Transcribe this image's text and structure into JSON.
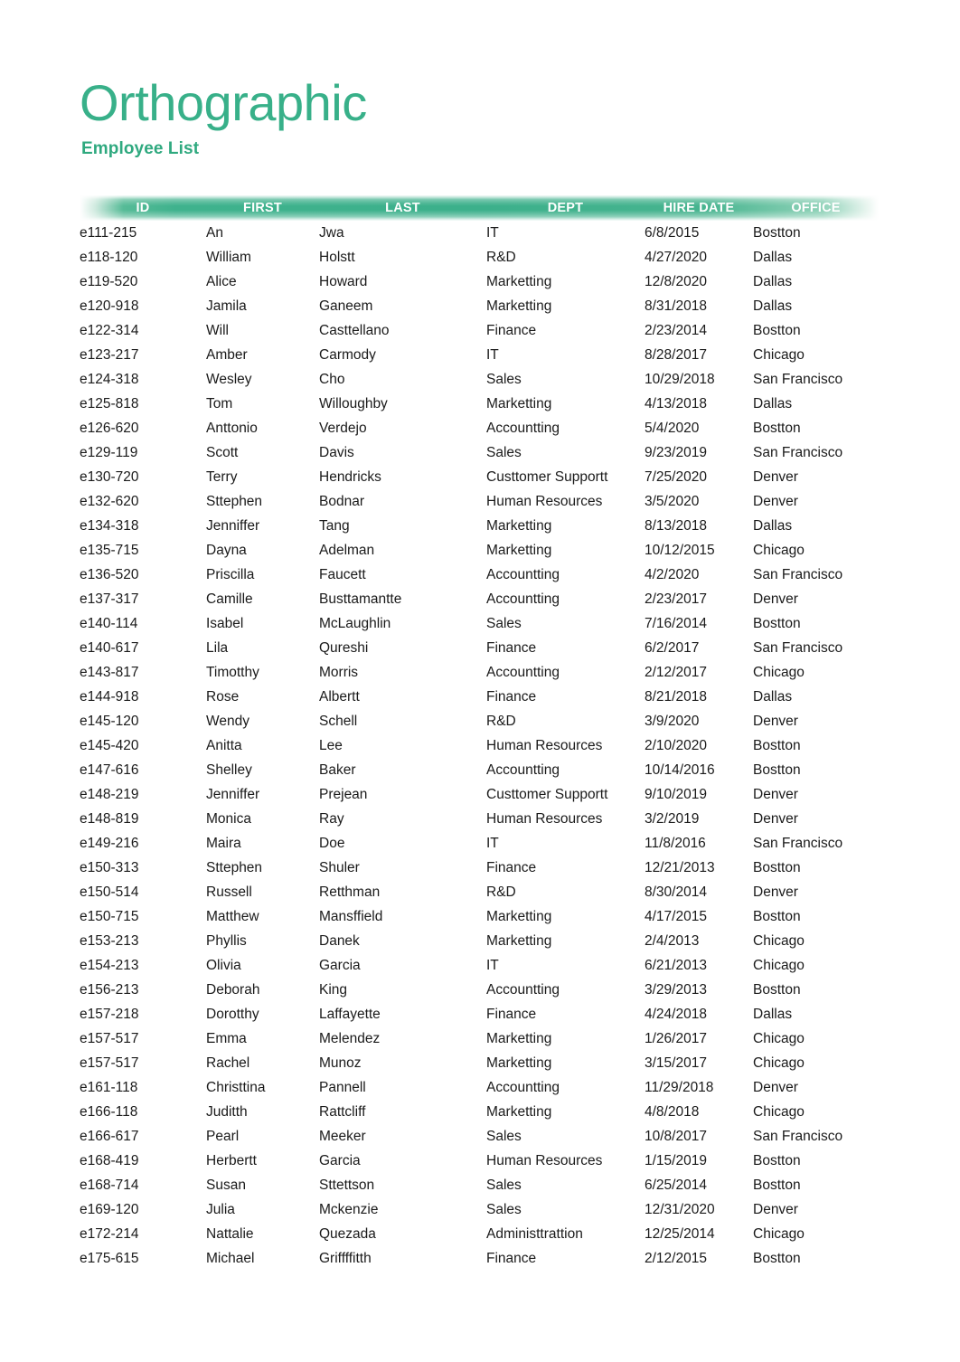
{
  "document": {
    "title": "Orthographic",
    "subtitle": "Employee List",
    "accent_color": "#38b089",
    "subtitle_color": "#2fa97f",
    "header_band_color": "#3cb08b",
    "text_color": "#1a1a1a"
  },
  "table": {
    "columns": [
      {
        "key": "id",
        "label": "ID"
      },
      {
        "key": "first",
        "label": "FIRST"
      },
      {
        "key": "last",
        "label": "LAST"
      },
      {
        "key": "dept",
        "label": "DEPT"
      },
      {
        "key": "hire",
        "label": "HIRE DATE"
      },
      {
        "key": "office",
        "label": "OFFICE"
      }
    ],
    "rows": [
      {
        "id": "e111-215",
        "first": "An",
        "last": "Jwa",
        "dept": "IT",
        "hire": "6/8/2015",
        "office": "Bostton"
      },
      {
        "id": "e118-120",
        "first": "William",
        "last": "Holstt",
        "dept": "R&D",
        "hire": "4/27/2020",
        "office": "Dallas"
      },
      {
        "id": "e119-520",
        "first": "Alice",
        "last": "Howard",
        "dept": "Marketting",
        "hire": "12/8/2020",
        "office": "Dallas"
      },
      {
        "id": "e120-918",
        "first": "Jamila",
        "last": "Ganeem",
        "dept": "Marketting",
        "hire": "8/31/2018",
        "office": "Dallas"
      },
      {
        "id": "e122-314",
        "first": "Will",
        "last": "Casttellano",
        "dept": "Finance",
        "hire": "2/23/2014",
        "office": "Bostton"
      },
      {
        "id": "e123-217",
        "first": "Amber",
        "last": "Carmody",
        "dept": "IT",
        "hire": "8/28/2017",
        "office": "Chicago"
      },
      {
        "id": "e124-318",
        "first": "Wesley",
        "last": "Cho",
        "dept": "Sales",
        "hire": "10/29/2018",
        "office": "San Francisco"
      },
      {
        "id": "e125-818",
        "first": "Tom",
        "last": "Willoughby",
        "dept": "Marketting",
        "hire": "4/13/2018",
        "office": "Dallas"
      },
      {
        "id": "e126-620",
        "first": "Anttonio",
        "last": "Verdejo",
        "dept": "Accountting",
        "hire": "5/4/2020",
        "office": "Bostton"
      },
      {
        "id": "e129-119",
        "first": "Scott",
        "last": "Davis",
        "dept": "Sales",
        "hire": "9/23/2019",
        "office": "San Francisco"
      },
      {
        "id": "e130-720",
        "first": "Terry",
        "last": "Hendricks",
        "dept": "Custtomer Supportt",
        "hire": "7/25/2020",
        "office": "Denver"
      },
      {
        "id": "e132-620",
        "first": "Sttephen",
        "last": "Bodnar",
        "dept": "Human Resources",
        "hire": "3/5/2020",
        "office": "Denver"
      },
      {
        "id": "e134-318",
        "first": "Jenniffer",
        "last": "Tang",
        "dept": "Marketting",
        "hire": "8/13/2018",
        "office": "Dallas"
      },
      {
        "id": "e135-715",
        "first": "Dayna",
        "last": "Adelman",
        "dept": "Marketting",
        "hire": "10/12/2015",
        "office": "Chicago"
      },
      {
        "id": "e136-520",
        "first": "Priscilla",
        "last": "Faucett",
        "dept": "Accountting",
        "hire": "4/2/2020",
        "office": "San Francisco"
      },
      {
        "id": "e137-317",
        "first": "Camille",
        "last": "Busttamantte",
        "dept": "Accountting",
        "hire": "2/23/2017",
        "office": "Denver"
      },
      {
        "id": "e140-114",
        "first": "Isabel",
        "last": "McLaughlin",
        "dept": "Sales",
        "hire": "7/16/2014",
        "office": "Bostton"
      },
      {
        "id": "e140-617",
        "first": "Lila",
        "last": "Qureshi",
        "dept": "Finance",
        "hire": "6/2/2017",
        "office": "San Francisco"
      },
      {
        "id": "e143-817",
        "first": "Timotthy",
        "last": "Morris",
        "dept": "Accountting",
        "hire": "2/12/2017",
        "office": "Chicago"
      },
      {
        "id": "e144-918",
        "first": "Rose",
        "last": "Albertt",
        "dept": "Finance",
        "hire": "8/21/2018",
        "office": "Dallas"
      },
      {
        "id": "e145-120",
        "first": "Wendy",
        "last": "Schell",
        "dept": "R&D",
        "hire": "3/9/2020",
        "office": "Denver"
      },
      {
        "id": "e145-420",
        "first": "Anitta",
        "last": "Lee",
        "dept": "Human Resources",
        "hire": "2/10/2020",
        "office": "Bostton"
      },
      {
        "id": "e147-616",
        "first": "Shelley",
        "last": "Baker",
        "dept": "Accountting",
        "hire": "10/14/2016",
        "office": "Bostton"
      },
      {
        "id": "e148-219",
        "first": "Jenniffer",
        "last": "Prejean",
        "dept": "Custtomer Supportt",
        "hire": "9/10/2019",
        "office": "Denver"
      },
      {
        "id": "e148-819",
        "first": "Monica",
        "last": "Ray",
        "dept": "Human Resources",
        "hire": "3/2/2019",
        "office": "Denver"
      },
      {
        "id": "e149-216",
        "first": "Maira",
        "last": "Doe",
        "dept": "IT",
        "hire": "11/8/2016",
        "office": "San Francisco"
      },
      {
        "id": "e150-313",
        "first": "Sttephen",
        "last": "Shuler",
        "dept": "Finance",
        "hire": "12/21/2013",
        "office": "Bostton"
      },
      {
        "id": "e150-514",
        "first": "Russell",
        "last": "Retthman",
        "dept": "R&D",
        "hire": "8/30/2014",
        "office": "Denver"
      },
      {
        "id": "e150-715",
        "first": "Matthew",
        "last": "Mansffield",
        "dept": "Marketting",
        "hire": "4/17/2015",
        "office": "Bostton"
      },
      {
        "id": "e153-213",
        "first": "Phyllis",
        "last": "Danek",
        "dept": "Marketting",
        "hire": "2/4/2013",
        "office": "Chicago"
      },
      {
        "id": "e154-213",
        "first": "Olivia",
        "last": "Garcia",
        "dept": "IT",
        "hire": "6/21/2013",
        "office": "Chicago"
      },
      {
        "id": "e156-213",
        "first": "Deborah",
        "last": "King",
        "dept": "Accountting",
        "hire": "3/29/2013",
        "office": "Bostton"
      },
      {
        "id": "e157-218",
        "first": "Dorotthy",
        "last": "Laffayette",
        "dept": "Finance",
        "hire": "4/24/2018",
        "office": "Dallas"
      },
      {
        "id": "e157-517",
        "first": "Emma",
        "last": "Melendez",
        "dept": "Marketting",
        "hire": "1/26/2017",
        "office": "Chicago"
      },
      {
        "id": "e157-517",
        "first": "Rachel",
        "last": "Munoz",
        "dept": "Marketting",
        "hire": "3/15/2017",
        "office": "Chicago"
      },
      {
        "id": "e161-118",
        "first": "Christtina",
        "last": "Pannell",
        "dept": "Accountting",
        "hire": "11/29/2018",
        "office": "Denver"
      },
      {
        "id": "e166-118",
        "first": "Juditth",
        "last": "Rattcliff",
        "dept": "Marketting",
        "hire": "4/8/2018",
        "office": "Chicago"
      },
      {
        "id": "e166-617",
        "first": "Pearl",
        "last": "Meeker",
        "dept": "Sales",
        "hire": "10/8/2017",
        "office": "San Francisco"
      },
      {
        "id": "e168-419",
        "first": "Herbertt",
        "last": "Garcia",
        "dept": "Human Resources",
        "hire": "1/15/2019",
        "office": "Bostton"
      },
      {
        "id": "e168-714",
        "first": "Susan",
        "last": "Sttettson",
        "dept": "Sales",
        "hire": "6/25/2014",
        "office": "Bostton"
      },
      {
        "id": "e169-120",
        "first": "Julia",
        "last": "Mckenzie",
        "dept": "Sales",
        "hire": "12/31/2020",
        "office": "Denver"
      },
      {
        "id": "e172-214",
        "first": "Nattalie",
        "last": "Quezada",
        "dept": "Administtrattion",
        "hire": "12/25/2014",
        "office": "Chicago"
      },
      {
        "id": "e175-615",
        "first": "Michael",
        "last": "Griffffitth",
        "dept": "Finance",
        "hire": "2/12/2015",
        "office": "Bostton"
      }
    ]
  }
}
